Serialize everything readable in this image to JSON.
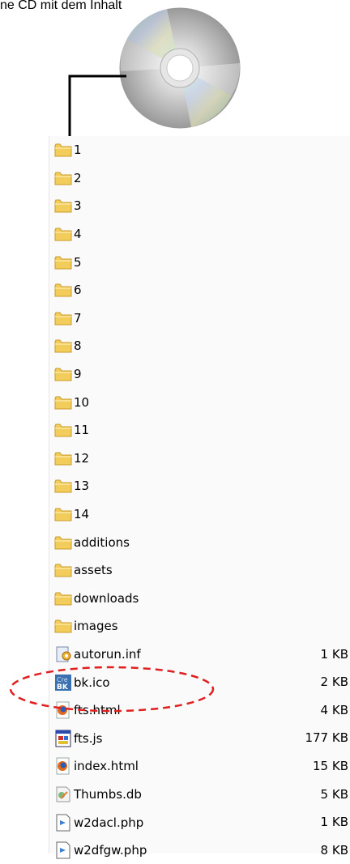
{
  "caption": "ne CD mit dem Inhalt",
  "colors": {
    "folder": "#f2cd5c",
    "folder_edge": "#c99b2a",
    "highlight": "#e02020"
  },
  "files": [
    {
      "name": "1",
      "icon": "folder-icon",
      "size": ""
    },
    {
      "name": "2",
      "icon": "folder-icon",
      "size": ""
    },
    {
      "name": "3",
      "icon": "folder-icon",
      "size": ""
    },
    {
      "name": "4",
      "icon": "folder-icon",
      "size": ""
    },
    {
      "name": "5",
      "icon": "folder-icon",
      "size": ""
    },
    {
      "name": "6",
      "icon": "folder-icon",
      "size": ""
    },
    {
      "name": "7",
      "icon": "folder-icon",
      "size": ""
    },
    {
      "name": "8",
      "icon": "folder-icon",
      "size": ""
    },
    {
      "name": "9",
      "icon": "folder-icon",
      "size": ""
    },
    {
      "name": "10",
      "icon": "folder-icon",
      "size": ""
    },
    {
      "name": "11",
      "icon": "folder-icon",
      "size": ""
    },
    {
      "name": "12",
      "icon": "folder-icon",
      "size": ""
    },
    {
      "name": "13",
      "icon": "folder-icon",
      "size": ""
    },
    {
      "name": "14",
      "icon": "folder-icon",
      "size": ""
    },
    {
      "name": "additions",
      "icon": "folder-icon",
      "size": ""
    },
    {
      "name": "assets",
      "icon": "folder-icon",
      "size": ""
    },
    {
      "name": "downloads",
      "icon": "folder-icon",
      "size": ""
    },
    {
      "name": "images",
      "icon": "folder-icon",
      "size": ""
    },
    {
      "name": "autorun.inf",
      "icon": "settings-file-icon",
      "size": "1 KB"
    },
    {
      "name": "bk.ico",
      "icon": "image-file-icon",
      "size": "2 KB"
    },
    {
      "name": "fts.html",
      "icon": "firefox-icon",
      "size": "4 KB"
    },
    {
      "name": "fts.js",
      "icon": "script-file-icon",
      "size": "177 KB"
    },
    {
      "name": "index.html",
      "icon": "firefox-icon",
      "size": "15 KB"
    },
    {
      "name": "Thumbs.db",
      "icon": "thumbs-file-icon",
      "size": "5 KB"
    },
    {
      "name": "w2dacl.php",
      "icon": "php-file-icon",
      "size": "1 KB"
    },
    {
      "name": "w2dfgw.php",
      "icon": "php-file-icon",
      "size": "8 KB"
    }
  ]
}
